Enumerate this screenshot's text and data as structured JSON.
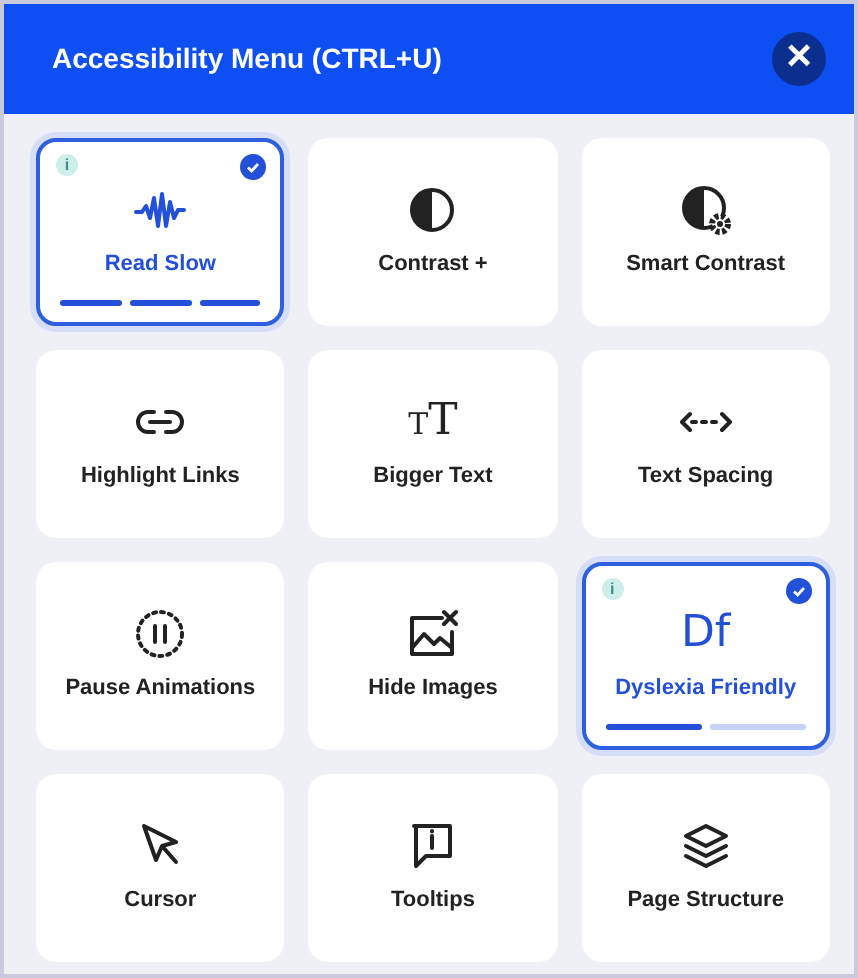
{
  "header": {
    "title": "Accessibility Menu (CTRL+U)",
    "close": "×"
  },
  "tiles": [
    {
      "label": "Read Slow",
      "kind": "wave",
      "selected": true,
      "info": "i",
      "steps": [
        {
          "on": true
        },
        {
          "on": true
        },
        {
          "on": true
        }
      ]
    },
    {
      "label": "Contrast +",
      "kind": "contrast",
      "selected": false
    },
    {
      "label": "Smart Contrast",
      "kind": "smart",
      "selected": false
    },
    {
      "label": "Highlight Links",
      "kind": "link",
      "selected": false
    },
    {
      "label": "Bigger Text",
      "kind": "glyph",
      "glyph": "TT",
      "selected": false
    },
    {
      "label": "Text Spacing",
      "kind": "spacing",
      "selected": false
    },
    {
      "label": "Pause Animations",
      "kind": "pause",
      "selected": false
    },
    {
      "label": "Hide Images",
      "kind": "hide",
      "selected": false
    },
    {
      "label": "Dyslexia Friendly",
      "kind": "glyph",
      "glyph": "Df",
      "selected": true,
      "info": "i",
      "steps": [
        {
          "on": true
        },
        {
          "on": false
        }
      ]
    },
    {
      "label": "Cursor",
      "kind": "cursor",
      "selected": false
    },
    {
      "label": "Tooltips",
      "kind": "tooltip",
      "selected": false
    },
    {
      "label": "Page Structure",
      "kind": "layers",
      "selected": false
    }
  ]
}
